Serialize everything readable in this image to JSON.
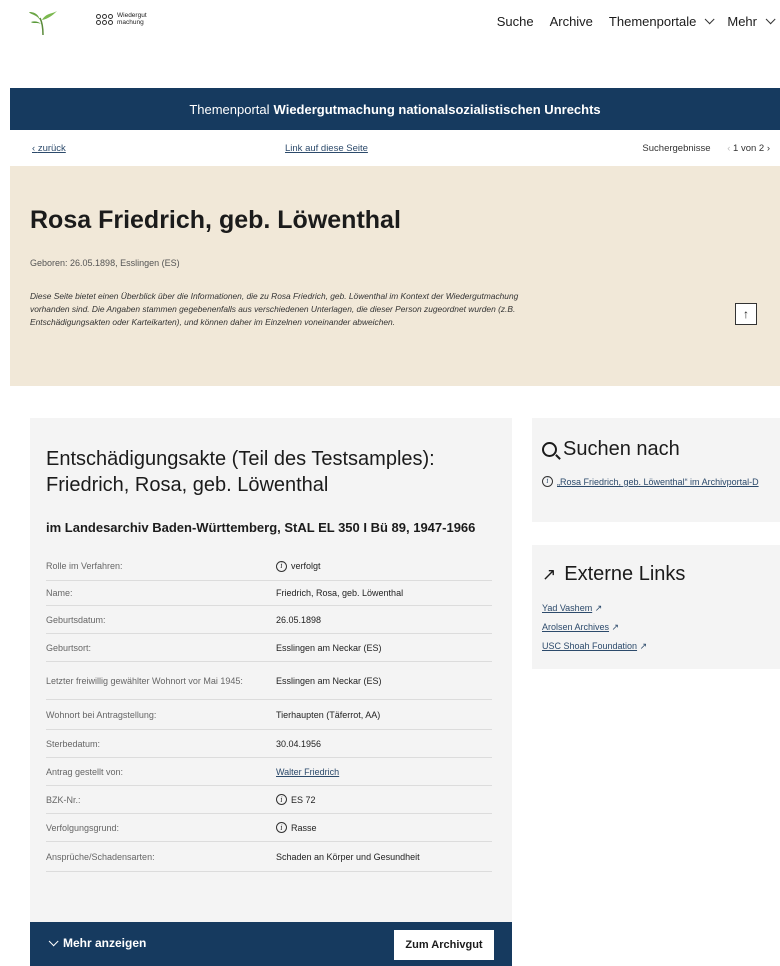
{
  "header": {
    "logo_text_line1": "Wiedergut",
    "logo_text_line2": "machung",
    "nav": {
      "search": "Suche",
      "archive": "Archive",
      "portals": "Themenportale",
      "more": "Mehr"
    }
  },
  "banner": {
    "prefix": "Themenportal",
    "title": "Wiedergutmachung nationalsozialistischen Unrechts"
  },
  "subnav": {
    "back": "zurück",
    "link": "Link auf diese Seite",
    "results_label": "Suchergebnisse",
    "results_page": "1 von 2"
  },
  "hero": {
    "name": "Rosa Friedrich, geb. Löwenthal",
    "born": "Geboren: 26.05.1898, Esslingen (ES)",
    "description": "Diese Seite bietet einen Überblick über die Informationen, die zu Rosa Friedrich, geb. Löwenthal im Kontext der Wiedergutmachung vorhanden sind. Die Angaben stammen gegebenenfalls aus verschiedenen Unterlagen, die dieser Person zugeordnet wurden (z.B. Entschädigungsakten oder Karteikarten), und können daher im Einzelnen voneinander abweichen."
  },
  "record": {
    "title": "Entschädigungsakte (Teil des Testsamples): Friedrich, Rosa, geb. Löwenthal",
    "subtitle": "im Landesarchiv Baden-Württemberg, StAL EL 350 I Bü 89, 1947-1966",
    "rows": [
      {
        "key": "Rolle im Verfahren:",
        "value": "verfolgt"
      },
      {
        "key": "Name:",
        "value": "Friedrich, Rosa, geb. Löwenthal"
      },
      {
        "key": "Geburtsdatum:",
        "value": "26.05.1898"
      },
      {
        "key": "Geburtsort:",
        "value": "Esslingen am Neckar (ES)"
      },
      {
        "key": "Letzter freiwillig gewählter Wohnort vor Mai 1945:",
        "value": "Esslingen am Neckar (ES)"
      },
      {
        "key": "Wohnort bei Antragstellung:",
        "value": "Tierhaupten (Täferrot, AA)"
      },
      {
        "key": "Sterbedatum:",
        "value": "30.04.1956"
      },
      {
        "key": "Antrag gestellt von:",
        "value": "Walter Friedrich"
      },
      {
        "key": "BZK-Nr.:",
        "value": "ES 72"
      },
      {
        "key": "Verfolgungsgrund:",
        "value": "Rasse"
      },
      {
        "key": "Ansprüche/Schadensarten:",
        "value": "Schaden an Körper und Gesundheit"
      }
    ],
    "more": "Mehr anzeigen",
    "archive_button": "Zum Archivgut"
  },
  "search_box": {
    "title": "Suchen nach",
    "link": "„Rosa Friedrich, geb. Löwenthal“ im Archivportal-D"
  },
  "links_box": {
    "title": "Externe Links",
    "links": [
      "Yad Vashem",
      "Arolsen Archives",
      "USC Shoah Foundation"
    ]
  },
  "colors": {
    "navy": "#163a5f",
    "beige": "#f1e8d8",
    "link": "#2c4a6b"
  }
}
